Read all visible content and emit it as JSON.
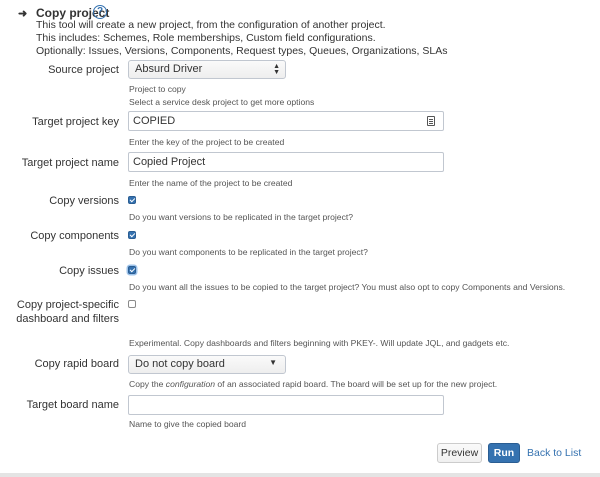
{
  "header": {
    "title": "Copy project",
    "help_icon": "question-circle-icon",
    "description": [
      "This tool will create a new project, from the configuration of another project.",
      "This includes: Schemes, Role memberships, Custom field configurations.",
      "Optionally: Issues, Versions, Components, Request types, Queues, Organizations, SLAs"
    ]
  },
  "form": {
    "source_project": {
      "label": "Source project",
      "value": "Absurd Driver",
      "help1": "Project to copy",
      "help2": "Select a service desk project to get more options"
    },
    "target_key": {
      "label": "Target project key",
      "value": "COPIED",
      "help": "Enter the key of the project to be created"
    },
    "target_name": {
      "label": "Target project name",
      "value": "Copied Project",
      "help": "Enter the name of the project to be created"
    },
    "copy_versions": {
      "label": "Copy versions",
      "checked": true,
      "help": "Do you want versions to be replicated in the target project?"
    },
    "copy_components": {
      "label": "Copy components",
      "checked": true,
      "help": "Do you want components to be replicated in the target project?"
    },
    "copy_issues": {
      "label": "Copy issues",
      "checked": true,
      "help": "Do you want all the issues to be copied to the target project? You must also opt to copy Components and Versions."
    },
    "copy_dashboards": {
      "label": "Copy project-specific dashboard and filters",
      "checked": false,
      "help": "Experimental. Copy dashboards and filters beginning with PKEY-. Will update JQL, and gadgets etc."
    },
    "copy_rapid_board": {
      "label": "Copy rapid board",
      "value": "Do not copy board",
      "help_pre": "Copy the ",
      "help_em": "configuration",
      "help_post": " of an associated rapid board. The board will be set up for the new project."
    },
    "target_board_name": {
      "label": "Target board name",
      "value": "",
      "help": "Name to give the copied board"
    }
  },
  "actions": {
    "preview": "Preview",
    "run": "Run",
    "back": "Back to List"
  },
  "colors": {
    "accent": "#3572b0"
  }
}
